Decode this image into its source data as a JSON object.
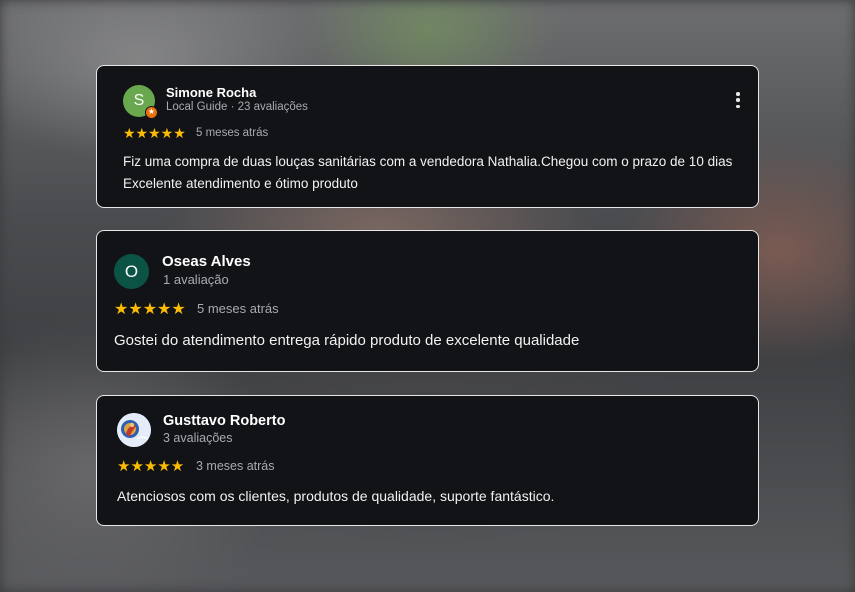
{
  "reviews": [
    {
      "name": "Simone Rocha",
      "subtitle": "Local Guide · 23 avaliações",
      "avatar_letter": "S",
      "avatar_color": "#6aa84f",
      "badge_icon": "star",
      "rating": 5,
      "stars": "★★★★★",
      "date": "5 meses atrás",
      "text_line1": "Fiz uma compra de duas louças sanitárias com a vendedora Nathalia.Chegou com o prazo de 10 dias",
      "text_line2": "Excelente atendimento e ótimo produto",
      "menu_icon": "more-vertical-icon"
    },
    {
      "name": "Oseas Alves",
      "subtitle": "1 avaliação",
      "avatar_letter": "O",
      "avatar_color": "#0b5345",
      "rating": 5,
      "stars": "★★★★★",
      "date": "5 meses atrás",
      "text": "Gostei do atendimento entrega rápido produto de excelente qualidade"
    },
    {
      "name": "Gusttavo Roberto",
      "subtitle": "3 avaliações",
      "avatar_icon": "profile-photo",
      "rating": 5,
      "stars": "★★★★★",
      "date": "3 meses atrás",
      "text": "Atenciosos com os clientes, produtos de qualidade, suporte fantástico."
    }
  ],
  "colors": {
    "card_bg": "#121317",
    "card_border": "#e7e7e7",
    "star": "#fbbc04",
    "muted_text": "#a9aaae"
  }
}
